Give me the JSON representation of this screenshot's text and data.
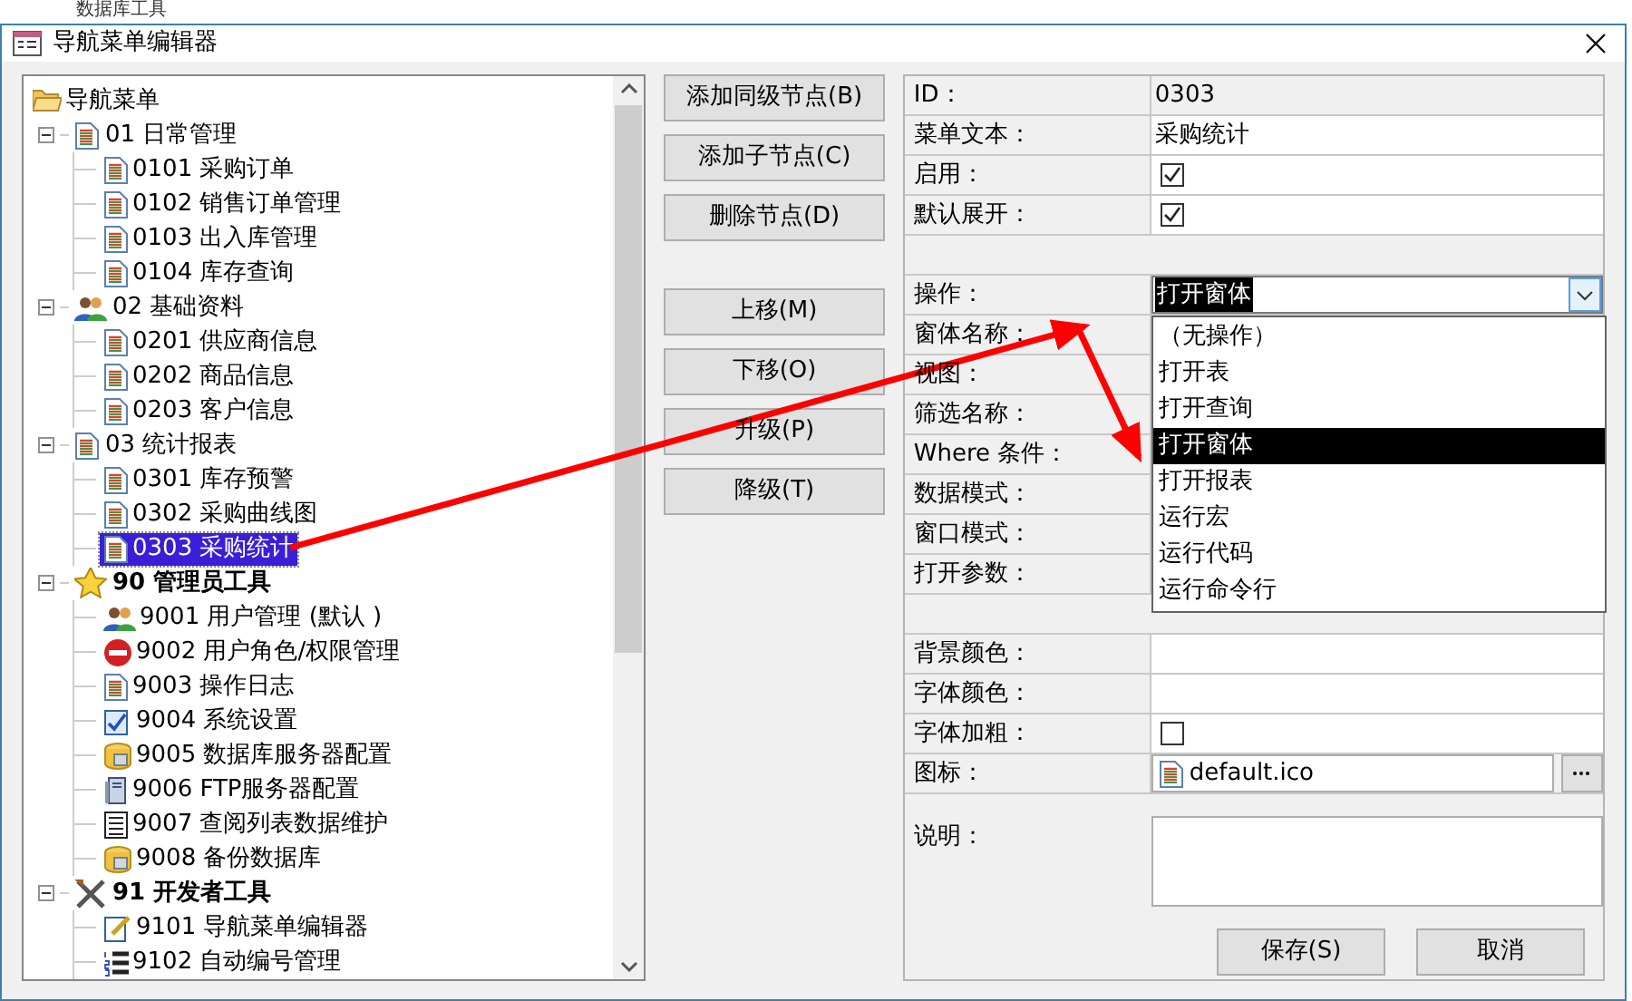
{
  "background_menu": [
    "数据库工具"
  ],
  "window": {
    "title": "导航菜单编辑器"
  },
  "tree": {
    "root": "导航菜单",
    "groups": [
      {
        "label": "01 日常管理",
        "kind": "doc",
        "bold": false,
        "expanded": true,
        "selected": false,
        "children": [
          {
            "label": "0101 采购订单",
            "kind": "doc",
            "selected": false
          },
          {
            "label": "0102 销售订单管理",
            "kind": "doc",
            "selected": false
          },
          {
            "label": "0103 出入库管理",
            "kind": "doc",
            "selected": false
          },
          {
            "label": "0104 库存查询",
            "kind": "doc",
            "selected": false
          }
        ]
      },
      {
        "label": "02 基础资料",
        "kind": "people",
        "bold": false,
        "expanded": true,
        "selected": false,
        "children": [
          {
            "label": "0201 供应商信息",
            "kind": "doc",
            "selected": false
          },
          {
            "label": "0202 商品信息",
            "kind": "doc",
            "selected": false
          },
          {
            "label": "0203 客户信息",
            "kind": "doc",
            "selected": false
          }
        ]
      },
      {
        "label": "03 统计报表",
        "kind": "doc",
        "bold": false,
        "expanded": true,
        "selected": false,
        "children": [
          {
            "label": "0301 库存预警",
            "kind": "doc",
            "selected": false
          },
          {
            "label": "0302 采购曲线图",
            "kind": "doc",
            "selected": false
          },
          {
            "label": "0303 采购统计",
            "kind": "doc",
            "selected": true
          }
        ]
      },
      {
        "label": "90 管理员工具",
        "kind": "star",
        "bold": true,
        "expanded": true,
        "selected": false,
        "children": [
          {
            "label": "9001 用户管理 (默认 )",
            "kind": "people",
            "selected": false
          },
          {
            "label": "9002 用户角色/权限管理",
            "kind": "stop",
            "selected": false
          },
          {
            "label": "9003 操作日志",
            "kind": "doc",
            "selected": false
          },
          {
            "label": "9004 系统设置",
            "kind": "check",
            "selected": false
          },
          {
            "label": "9005 数据库服务器配置",
            "kind": "database",
            "selected": false
          },
          {
            "label": "9006 FTP服务器配置",
            "kind": "server",
            "selected": false
          },
          {
            "label": "9007 查阅列表数据维护",
            "kind": "list",
            "selected": false
          },
          {
            "label": "9008 备份数据库",
            "kind": "database",
            "selected": false
          }
        ]
      },
      {
        "label": "91 开发者工具",
        "kind": "tools",
        "bold": true,
        "expanded": true,
        "selected": false,
        "children": [
          {
            "label": "9101 导航菜单编辑器",
            "kind": "edit",
            "selected": false
          },
          {
            "label": "9102 自动编号管理",
            "kind": "numbered",
            "selected": false
          }
        ]
      }
    ]
  },
  "node_buttons": [
    "添加同级节点(B)",
    "添加子节点(C)",
    "删除节点(D)"
  ],
  "move_buttons": [
    "上移(M)",
    "下移(O)",
    "升级(P)",
    "降级(T)"
  ],
  "properties": [
    {
      "kind": "readonly",
      "label": "ID：",
      "value": "0303"
    },
    {
      "kind": "text",
      "label": "菜单文本：",
      "value": "采购统计"
    },
    {
      "kind": "checkbox",
      "label": "启用：",
      "checked": true
    },
    {
      "kind": "checkbox",
      "label": "默认展开：",
      "checked": true
    },
    {
      "kind": "gap"
    },
    {
      "kind": "dropdown",
      "label": "操作：",
      "value": "打开窗体",
      "options": [
        {
          "label": "（无操作）",
          "selected": false
        },
        {
          "label": "打开表",
          "selected": false
        },
        {
          "label": "打开查询",
          "selected": false
        },
        {
          "label": "打开窗体",
          "selected": true
        },
        {
          "label": "打开报表",
          "selected": false
        },
        {
          "label": "运行宏",
          "selected": false
        },
        {
          "label": "运行代码",
          "selected": false
        },
        {
          "label": "运行命令行",
          "selected": false
        }
      ]
    },
    {
      "kind": "text",
      "label": "窗体名称："
    },
    {
      "kind": "text",
      "label": "视图："
    },
    {
      "kind": "text",
      "label": "筛选名称："
    },
    {
      "kind": "text",
      "label": "Where 条件："
    },
    {
      "kind": "text",
      "label": "数据模式："
    },
    {
      "kind": "text",
      "label": "窗口模式："
    },
    {
      "kind": "text",
      "label": "打开参数："
    },
    {
      "kind": "gap"
    },
    {
      "kind": "text",
      "label": "背景颜色："
    },
    {
      "kind": "text",
      "label": "字体颜色："
    },
    {
      "kind": "checkbox",
      "label": "字体加粗：",
      "checked": false
    },
    {
      "kind": "file",
      "label": "图标：",
      "value": "default.ico"
    },
    {
      "kind": "textarea",
      "label": "说明："
    }
  ],
  "footer_buttons": [
    "保存(S)",
    "取消"
  ]
}
